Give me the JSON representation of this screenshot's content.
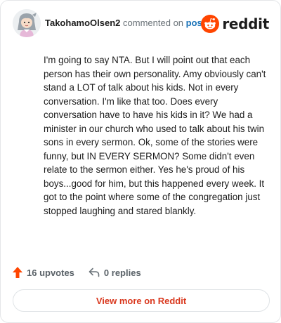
{
  "header": {
    "username": "TakohamoOlsen2",
    "action_text": "commented on",
    "post_link": "post",
    "brand": "reddit"
  },
  "comment": {
    "body": "I'm going to say NTA. But I will point out that each person has their own personality. Amy obviously can't stand a LOT of talk about his kids. Not in every conversation. I'm like that too. Does every conversation have to have his kids in it? We had a minister in our church who used to talk about his twin sons in every sermon. Ok, some of the stories were funny, but IN EVERY SERMON? Some didn't even relate to the sermon either. Yes he's proud of his boys...good for him, but this happened every week. It got to the point where some of the congregation just stopped laughing and stared blankly."
  },
  "footer": {
    "upvotes": "16 upvotes",
    "replies": "0 replies",
    "upvote_icon": "upvote-arrow-icon",
    "reply_icon": "reply-arrow-icon"
  },
  "cta": {
    "label": "View more on Reddit"
  },
  "colors": {
    "brand_orange": "#ff4500",
    "link_blue": "#1a73b8",
    "cta_red": "#d9381e"
  }
}
